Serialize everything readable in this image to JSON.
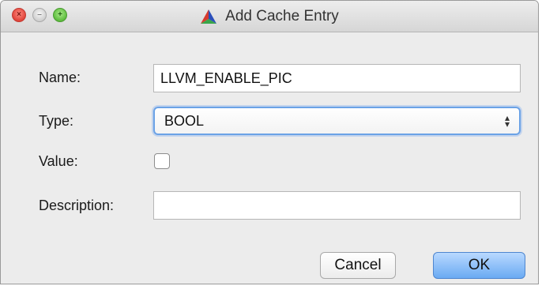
{
  "window": {
    "title": "Add Cache Entry",
    "app_icon": "cmake-triangle-icon"
  },
  "form": {
    "name_label": "Name:",
    "name_value": "LLVM_ENABLE_PIC",
    "type_label": "Type:",
    "type_value": "BOOL",
    "value_label": "Value:",
    "value_checked": false,
    "description_label": "Description:",
    "description_value": ""
  },
  "buttons": {
    "cancel": "Cancel",
    "ok": "OK"
  },
  "colors": {
    "focus_ring": "#6ba2e6",
    "ok_button": "#6aaaf2",
    "window_bg": "#ececec"
  }
}
